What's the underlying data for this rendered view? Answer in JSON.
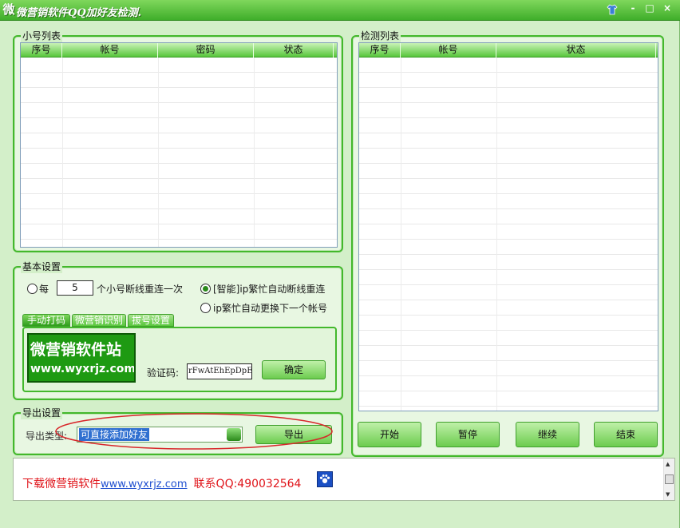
{
  "window": {
    "title": "微营销软件QQ加好友检测.",
    "app_icon": "微",
    "buttons": {
      "minimize": "-",
      "maximize": "□",
      "close": "×"
    },
    "accent_color": "#43b82c"
  },
  "account_list": {
    "label": "小号列表",
    "columns": [
      "序号",
      "帐号",
      "密码",
      "状态"
    ]
  },
  "check_list": {
    "label": "检测列表",
    "columns": [
      "序号",
      "帐号",
      "状态"
    ]
  },
  "basic_settings": {
    "label": "基本设置",
    "every_label": "每",
    "reconnect_count": "5",
    "reconnect_suffix": "个小号断线重连一次",
    "smart_reconnect_label": "[智能]ip繁忙自动断线重连",
    "switch_next_label": "ip繁忙自动更换下一个帐号",
    "tabs": [
      "手动打码",
      "微营销识别",
      "拔号设置"
    ],
    "captcha_banner": {
      "line1": "微营销软件站",
      "line2": "www.wyxrjz.com"
    },
    "captcha_label": "验证码:",
    "captcha_value": "rFwAtEhEpDpEx",
    "confirm_button": "确定"
  },
  "export_settings": {
    "label": "导出设置",
    "type_label": "导出类型:",
    "type_value": "可直接添加好友",
    "export_button": "导出"
  },
  "controls": [
    "开始",
    "暂停",
    "继续",
    "结束"
  ],
  "footer": {
    "download_text": "下载微营销软件",
    "link_text": "www.wyxrjz.com",
    "contact_text": "联系QQ:490032564"
  }
}
